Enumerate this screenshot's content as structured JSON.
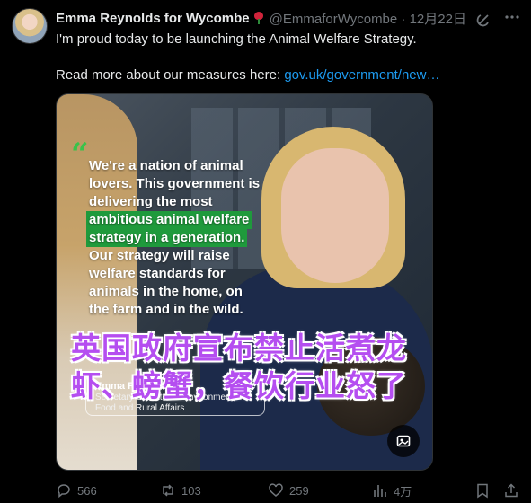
{
  "tweet": {
    "author_name": "Emma Reynolds for Wycombe",
    "handle": "@EmmaforWycombe",
    "dot": "·",
    "date": "12月22日",
    "text_line1": "I'm proud today to be launching the Animal Welfare Strategy.",
    "text_line2_prefix": "Read more about our measures here: ",
    "link_text": "gov.uk/government/new…"
  },
  "media": {
    "quote_lines": [
      "We're a nation of animal",
      "lovers. This government is",
      "delivering the most",
      "ambitious animal welfare",
      "strategy in a generation.",
      "Our strategy will raise",
      "welfare standards for",
      "animals in the home, on",
      "the farm and in the wild."
    ],
    "quote_open_mark": "“",
    "quote_close_mark": "”",
    "caption_name": "Emma Reynolds",
    "caption_role_line1": "Secretary of State for Environment,",
    "caption_role_line2": "Food and Rural Affairs",
    "overlay_line1": "英国政府宣布禁止活煮龙",
    "overlay_line2": "虾、螃蟹，餐饮行业怒了"
  },
  "actions": {
    "replies": "566",
    "reposts": "103",
    "likes": "259",
    "views": "4万"
  },
  "icons": {
    "header": [
      "grok-icon",
      "more-icon"
    ],
    "actions": [
      "reply-icon",
      "retweet-icon",
      "like-icon",
      "views-icon",
      "bookmark-icon",
      "share-icon"
    ],
    "media": [
      "alt-text-icon"
    ]
  },
  "colors": {
    "link": "#1d9bf0",
    "muted": "#71767b",
    "highlight_green": "#1f9a3c",
    "overlay_purple": "#b54ef0"
  }
}
